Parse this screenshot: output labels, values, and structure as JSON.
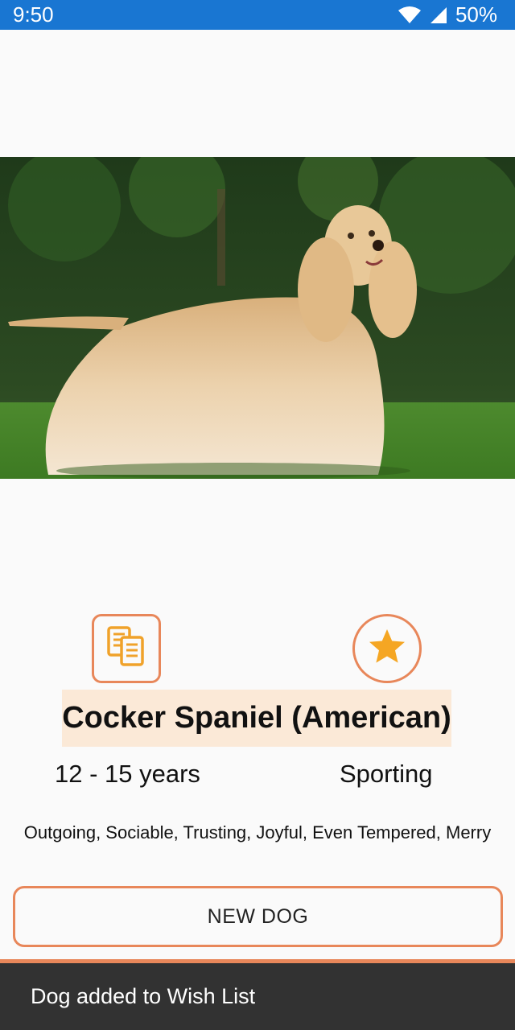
{
  "status_bar": {
    "time": "9:50",
    "battery": "50%",
    "icons": [
      "wifi-icon",
      "cell-signal-icon"
    ]
  },
  "dog": {
    "image": "cocker-spaniel-photo",
    "name": "Cocker Spaniel (American)",
    "life_span": "12 - 15 years",
    "breed_group": "Sporting",
    "temperament": "Outgoing, Sociable, Trusting, Joyful, Even Tempered, Merry"
  },
  "actions": {
    "copy_icon": "copy-documents-icon",
    "favorite_icon": "star-icon",
    "new_dog_label": "NEW DOG"
  },
  "snackbar": {
    "message": "Dog added to Wish List"
  },
  "colors": {
    "status_bar": "#1976d2",
    "accent": "#e8875a",
    "star": "#f5a623",
    "name_highlight": "#fbe9d7",
    "snackbar": "#323232"
  }
}
